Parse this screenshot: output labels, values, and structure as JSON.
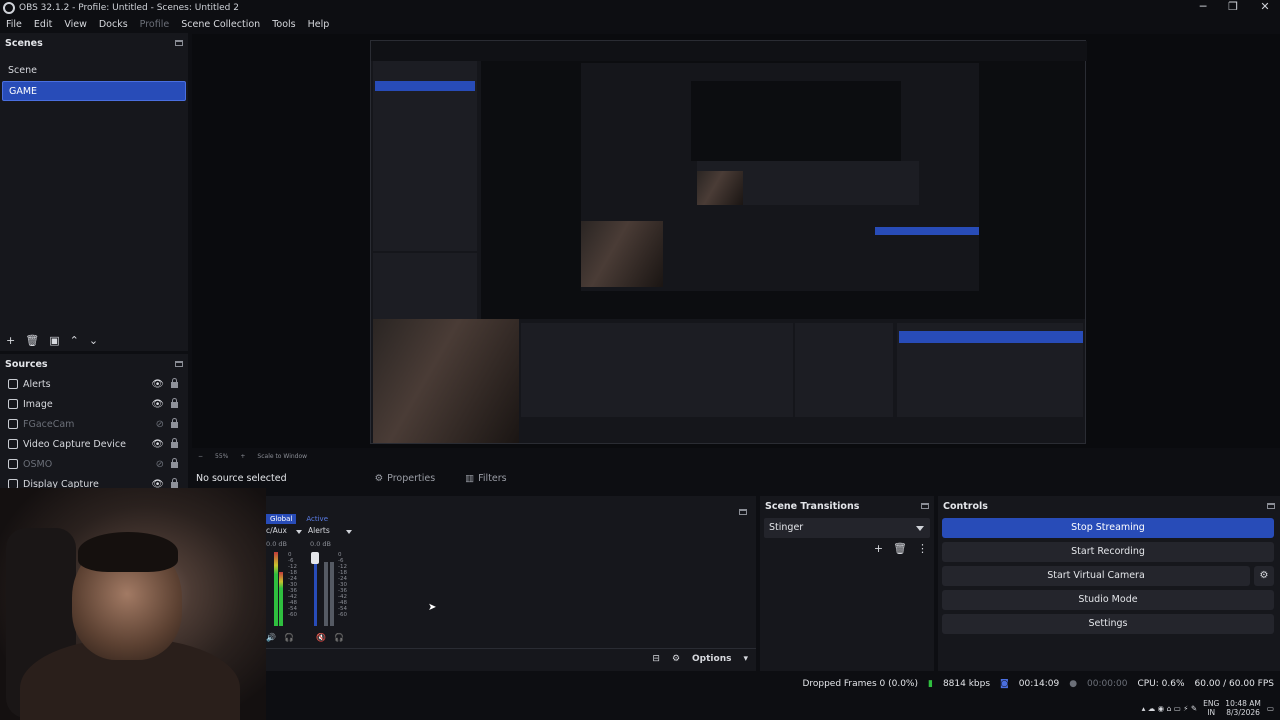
{
  "window": {
    "title": "OBS 32.1.2 - Profile: Untitled - Scenes: Untitled 2",
    "min": "─",
    "restore": "❐",
    "close": "✕"
  },
  "menu": [
    "File",
    "Edit",
    "View",
    "Docks",
    "Profile",
    "Scene Collection",
    "Tools",
    "Help"
  ],
  "scenes": {
    "title": "Scenes",
    "items": [
      "Scene",
      "GAME"
    ],
    "selected": "GAME"
  },
  "sources": {
    "title": "Sources",
    "items": [
      {
        "label": "Alerts",
        "visible": true
      },
      {
        "label": "Image",
        "visible": true
      },
      {
        "label": "FGaceCam",
        "visible": false
      },
      {
        "label": "Video Capture Device",
        "visible": true
      },
      {
        "label": "OSMO",
        "visible": false
      },
      {
        "label": "Display Capture",
        "visible": true
      }
    ]
  },
  "preview": {
    "zoom": "55%",
    "scale_mode": "Scale to Window"
  },
  "properties_bar": {
    "no_source": "No source selected",
    "properties": "Properties",
    "filters": "Filters"
  },
  "mixer": {
    "tabs": [
      "Global",
      "Active"
    ],
    "channels": [
      {
        "name": "c/Aux",
        "db": "0.0 dB"
      },
      {
        "name": "Alerts",
        "db": "0.0 dB"
      }
    ],
    "scale": [
      "0",
      "-6",
      "-12",
      "-18",
      "-24",
      "-30",
      "-36",
      "-42",
      "-48",
      "-54",
      "-60"
    ],
    "options": "Options"
  },
  "transitions": {
    "title": "Scene Transitions",
    "selected": "Stinger"
  },
  "controls": {
    "title": "Controls",
    "stop_streaming": "Stop Streaming",
    "start_recording": "Start Recording",
    "start_virtual_camera": "Start Virtual Camera",
    "studio_mode": "Studio Mode",
    "settings": "Settings"
  },
  "status": {
    "dropped": "Dropped Frames 0 (0.0%)",
    "bitrate": "8814 kbps",
    "stream_time": "00:14:09",
    "rec_time": "00:00:00",
    "cpu": "CPU: 0.6%",
    "fps": "60.00 / 60.00 FPS"
  },
  "taskbar": {
    "lang": "ENG",
    "region": "IN",
    "time": "10:48 AM",
    "date": "8/3/2026"
  },
  "colors": {
    "accent": "#284cb8",
    "panel": "#16171c",
    "bg": "#0d0e12"
  }
}
